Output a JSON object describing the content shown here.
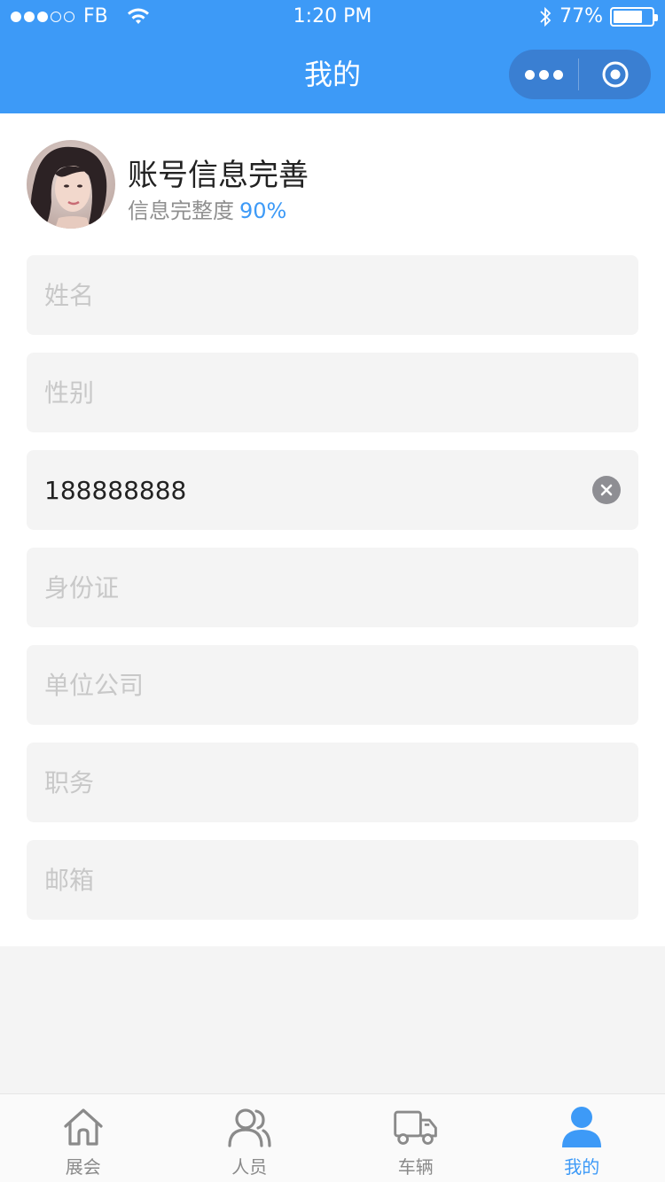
{
  "status_bar": {
    "carrier": "FB",
    "time": "1:20 PM",
    "battery": "77%",
    "battery_level": 0.77
  },
  "nav": {
    "title": "我的",
    "more_icon": "more-icon",
    "close_icon": "target-icon"
  },
  "profile": {
    "title": "账号信息完善",
    "completeness_label": "信息完整度",
    "completeness_value": "90%"
  },
  "form": {
    "name": {
      "placeholder": "姓名",
      "value": ""
    },
    "gender": {
      "placeholder": "性别",
      "value": ""
    },
    "phone": {
      "placeholder": "",
      "value": "188888888"
    },
    "id_card": {
      "placeholder": "身份证",
      "value": ""
    },
    "company": {
      "placeholder": "单位公司",
      "value": ""
    },
    "position": {
      "placeholder": "职务",
      "value": ""
    },
    "email": {
      "placeholder": "邮箱",
      "value": ""
    }
  },
  "tabs": [
    {
      "label": "展会",
      "icon": "home-icon",
      "active": false
    },
    {
      "label": "人员",
      "icon": "people-icon",
      "active": false
    },
    {
      "label": "车辆",
      "icon": "truck-icon",
      "active": false
    },
    {
      "label": "我的",
      "icon": "user-icon",
      "active": true
    }
  ],
  "colors": {
    "primary": "#3d9af7",
    "capsule": "#3a7fd2",
    "field_bg": "#f4f4f4",
    "inactive": "#8a8a8a"
  }
}
